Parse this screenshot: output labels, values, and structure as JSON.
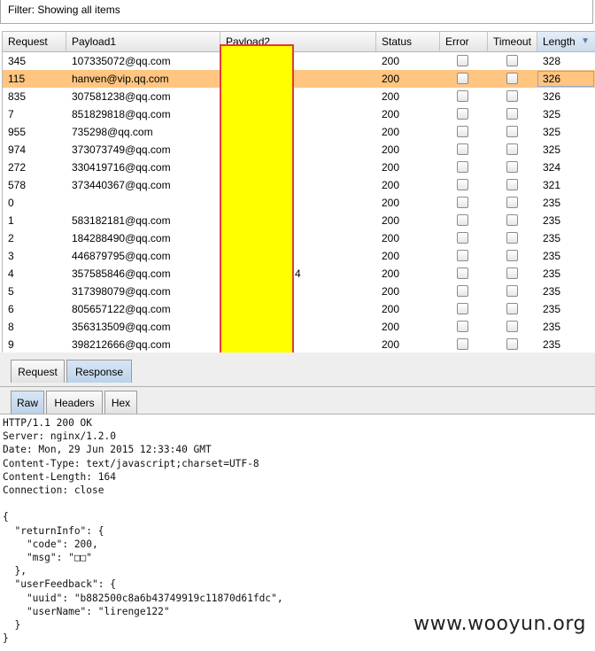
{
  "filter": {
    "text": "Filter: Showing all items"
  },
  "table": {
    "columns": [
      "Request",
      "Payload1",
      "Payload2",
      "Status",
      "Error",
      "Timeout",
      "Length"
    ],
    "sort_indicator": "▼",
    "rows": [
      {
        "request": "345",
        "payload1": "107335072@qq.com",
        "payload2": "",
        "status": "200",
        "error": false,
        "timeout": false,
        "length": "328",
        "selected": false
      },
      {
        "request": "115",
        "payload1": "hanven@vip.qq.com",
        "payload2": "",
        "status": "200",
        "error": false,
        "timeout": false,
        "length": "326",
        "selected": true
      },
      {
        "request": "835",
        "payload1": "307581238@qq.com",
        "payload2": "",
        "status": "200",
        "error": false,
        "timeout": false,
        "length": "326",
        "selected": false
      },
      {
        "request": "7",
        "payload1": "851829818@qq.com",
        "payload2": "",
        "status": "200",
        "error": false,
        "timeout": false,
        "length": "325",
        "selected": false
      },
      {
        "request": "955",
        "payload1": "735298@qq.com",
        "payload2": "",
        "status": "200",
        "error": false,
        "timeout": false,
        "length": "325",
        "selected": false
      },
      {
        "request": "974",
        "payload1": "373073749@qq.com",
        "payload2": "",
        "status": "200",
        "error": false,
        "timeout": false,
        "length": "325",
        "selected": false
      },
      {
        "request": "272",
        "payload1": "330419716@qq.com",
        "payload2": "",
        "status": "200",
        "error": false,
        "timeout": false,
        "length": "324",
        "selected": false
      },
      {
        "request": "578",
        "payload1": "373440367@qq.com",
        "payload2": "",
        "status": "200",
        "error": false,
        "timeout": false,
        "length": "321",
        "selected": false
      },
      {
        "request": "0",
        "payload1": "",
        "payload2": "",
        "status": "200",
        "error": false,
        "timeout": false,
        "length": "235",
        "selected": false
      },
      {
        "request": "1",
        "payload1": "583182181@qq.com",
        "payload2": "",
        "status": "200",
        "error": false,
        "timeout": false,
        "length": "235",
        "selected": false
      },
      {
        "request": "2",
        "payload1": "184288490@qq.com",
        "payload2": "",
        "status": "200",
        "error": false,
        "timeout": false,
        "length": "235",
        "selected": false
      },
      {
        "request": "3",
        "payload1": "446879795@qq.com",
        "payload2": "",
        "status": "200",
        "error": false,
        "timeout": false,
        "length": "235",
        "selected": false
      },
      {
        "request": "4",
        "payload1": "357585846@qq.com",
        "payload2": "4",
        "status": "200",
        "error": false,
        "timeout": false,
        "length": "235",
        "selected": false
      },
      {
        "request": "5",
        "payload1": "317398079@qq.com",
        "payload2": "",
        "status": "200",
        "error": false,
        "timeout": false,
        "length": "235",
        "selected": false
      },
      {
        "request": "6",
        "payload1": "805657122@qq.com",
        "payload2": "",
        "status": "200",
        "error": false,
        "timeout": false,
        "length": "235",
        "selected": false
      },
      {
        "request": "8",
        "payload1": "356313509@qq.com",
        "payload2": "",
        "status": "200",
        "error": false,
        "timeout": false,
        "length": "235",
        "selected": false
      },
      {
        "request": "9",
        "payload1": "398212666@qq.com",
        "payload2": "",
        "status": "200",
        "error": false,
        "timeout": false,
        "length": "235",
        "selected": false
      }
    ]
  },
  "tabs_top": [
    "Request",
    "Response"
  ],
  "tabs_sub": [
    "Raw",
    "Headers",
    "Hex"
  ],
  "response_lines": [
    "HTTP/1.1 200 OK",
    "Server: nginx/1.2.0",
    "Date: Mon, 29 Jun 2015 12:33:40 GMT",
    "Content-Type: text/javascript;charset=UTF-8",
    "Content-Length: 164",
    "Connection: close",
    "",
    "{",
    "  \"returnInfo\": {",
    "    \"code\": 200,",
    "    \"msg\": \"□□\"",
    "  },",
    "  \"userFeedback\": {",
    "    \"uuid\": \"b882500c8a6b43749919c11870d61fdc\",",
    "    \"userName\": \"lirenge122\"",
    "  }",
    "}"
  ],
  "watermark": "www.wooyun.org",
  "colors": {
    "selected_row": "#ffc581",
    "redaction_fill": "#ffff00",
    "redaction_border": "#e23a3a"
  }
}
